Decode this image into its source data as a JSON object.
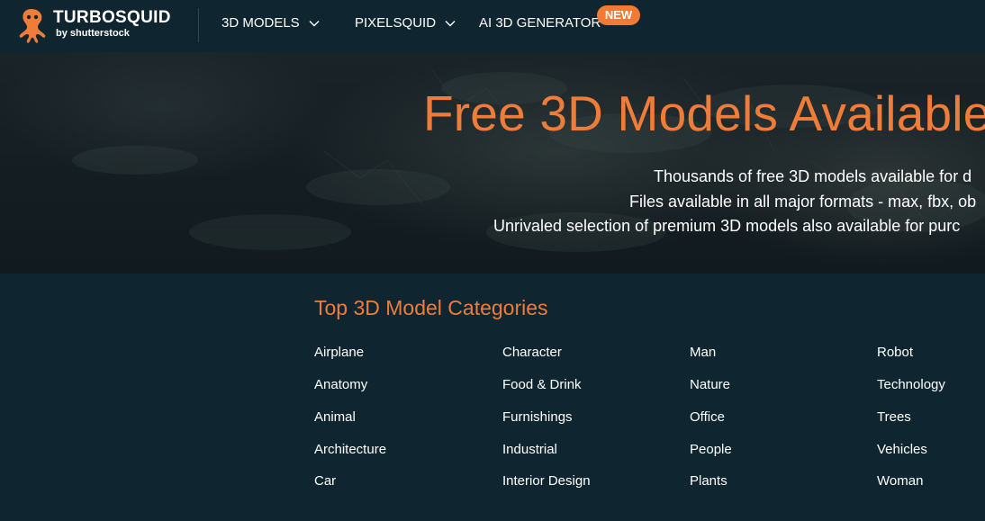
{
  "header": {
    "brand": "TURBOSQUID",
    "brand_sub": "by shutterstock",
    "logo_icon": "squid-logo-icon",
    "nav": [
      {
        "label": "3D MODELS",
        "icon": "chevron-down-icon"
      },
      {
        "label": "PIXELSQUID",
        "icon": "chevron-down-icon"
      },
      {
        "label": "AI 3D GENERATOR",
        "badge": "NEW"
      }
    ]
  },
  "hero": {
    "title": "Free 3D Models Available",
    "lines": [
      "Thousands of free 3D models available for d",
      "Files available in all major formats - max, fbx, ob",
      "Unrivaled selection of premium 3D models also available for purc"
    ]
  },
  "categories": {
    "title": "Top 3D Model Categories",
    "columns": [
      [
        "Airplane",
        "Anatomy",
        "Animal",
        "Architecture",
        "Car"
      ],
      [
        "Character",
        "Food & Drink",
        "Furnishings",
        "Industrial",
        "Interior Design"
      ],
      [
        "Man",
        "Nature",
        "Office",
        "People",
        "Plants"
      ],
      [
        "Robot",
        "Technology",
        "Trees",
        "Vehicles",
        "Woman"
      ]
    ]
  },
  "colors": {
    "accent": "#f07c3a",
    "badge": "#f27a35",
    "background": "#0f2631",
    "text": "#ffffff"
  }
}
